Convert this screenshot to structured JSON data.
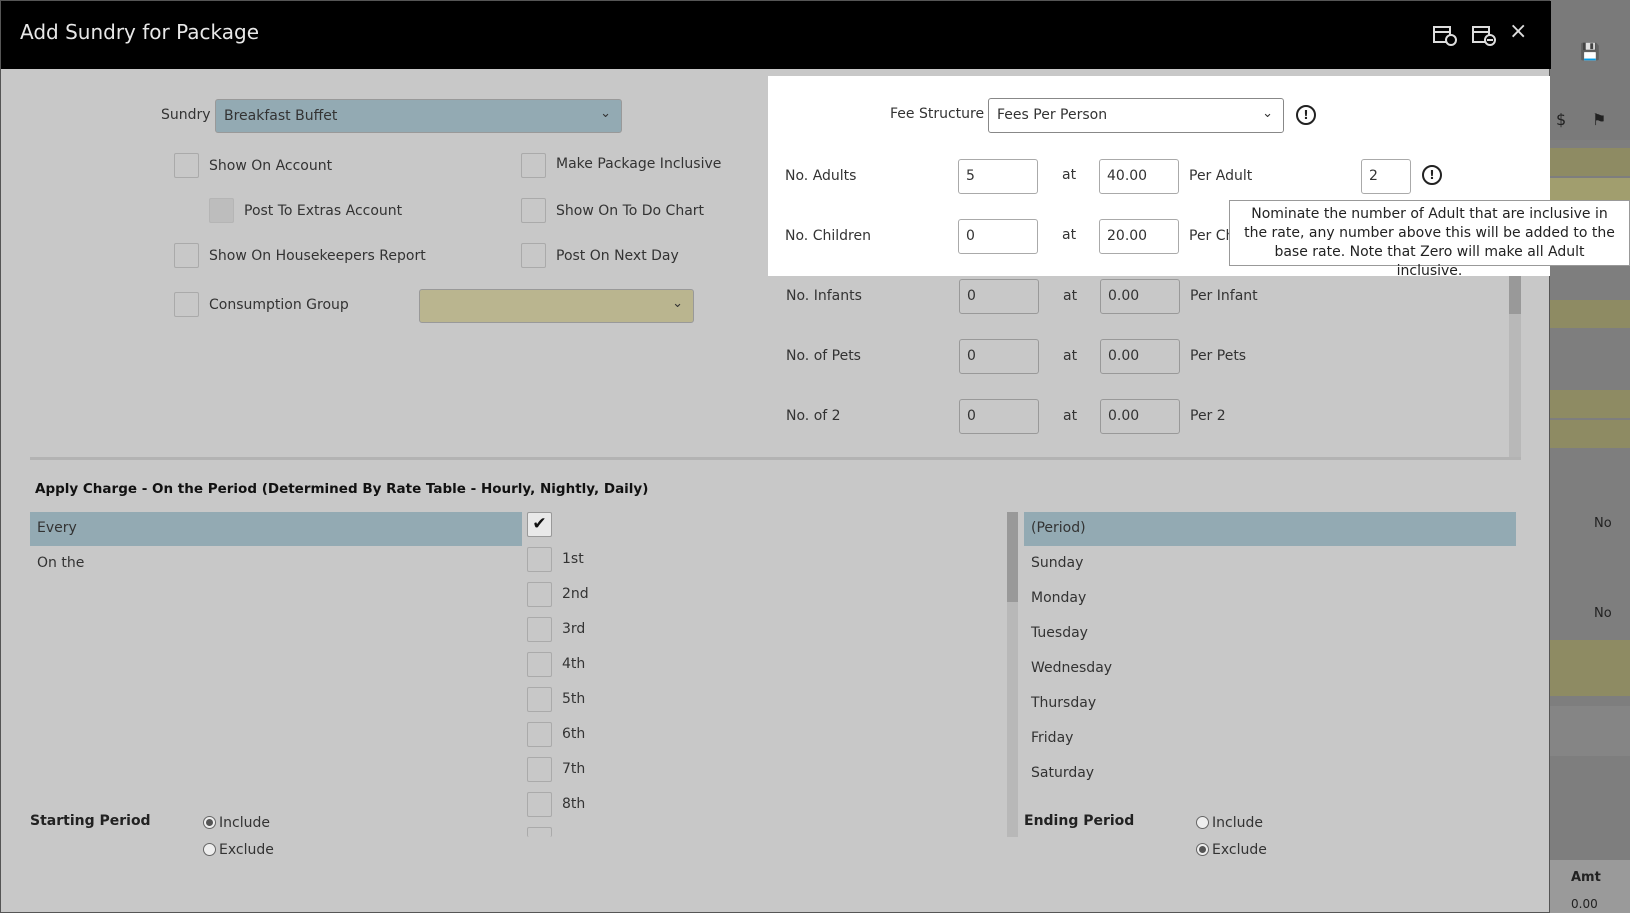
{
  "dialog": {
    "title": "Add Sundry for Package"
  },
  "toolbar": {
    "icon1": "calendar-settings-icon",
    "icon2": "calendar-settings-alt-icon",
    "close": "×"
  },
  "sundry": {
    "label": "Sundry",
    "value": "Breakfast Buffet"
  },
  "checkboxes": {
    "show_on_account": "Show On Account",
    "post_to_extras": "Post To Extras Account",
    "show_on_housekeepers": "Show On Housekeepers Report",
    "consumption_group": "Consumption Group",
    "make_package_inclusive": "Make Package Inclusive",
    "show_on_todo": "Show On To Do Chart",
    "post_next_day": "Post On Next Day"
  },
  "fees": {
    "label": "Fee Structure",
    "value": "Fees Per Person",
    "at": "at",
    "rows": [
      {
        "label": "No. Adults",
        "count": "5",
        "price": "40.00",
        "per": "Per Adult",
        "inclusive": "2"
      },
      {
        "label": "No. Children",
        "count": "0",
        "price": "20.00",
        "per": "Per Ch"
      },
      {
        "label": "No. Infants",
        "count": "0",
        "price": "0.00",
        "per": "Per Infant"
      },
      {
        "label": "No. of Pets",
        "count": "0",
        "price": "0.00",
        "per": "Per Pets"
      },
      {
        "label": "No. of 2",
        "count": "0",
        "price": "0.00",
        "per": "Per 2"
      }
    ]
  },
  "tooltip": "Nominate the number of Adult that are inclusive in the rate, any number above this will be added to the base rate. Note that Zero will make all Adult inclusive.",
  "apply": {
    "heading": "Apply Charge - On the Period (Determined By Rate Table - Hourly, Nightly, Daily)",
    "options": [
      "Every",
      "On the"
    ],
    "ordinals": [
      "1st",
      "2nd",
      "3rd",
      "4th",
      "5th",
      "6th",
      "7th",
      "8th"
    ],
    "periods": [
      "(Period)",
      "Sunday",
      "Monday",
      "Tuesday",
      "Wednesday",
      "Thursday",
      "Friday",
      "Saturday"
    ]
  },
  "starting": {
    "label": "Starting Period",
    "include": "Include",
    "exclude": "Exclude",
    "selected": "Include"
  },
  "ending": {
    "label": "Ending Period",
    "include": "Include",
    "exclude": "Exclude",
    "selected": "Exclude"
  },
  "background": {
    "no1": "No",
    "no2": "No",
    "amt": "Amt",
    "val": "0.00"
  }
}
